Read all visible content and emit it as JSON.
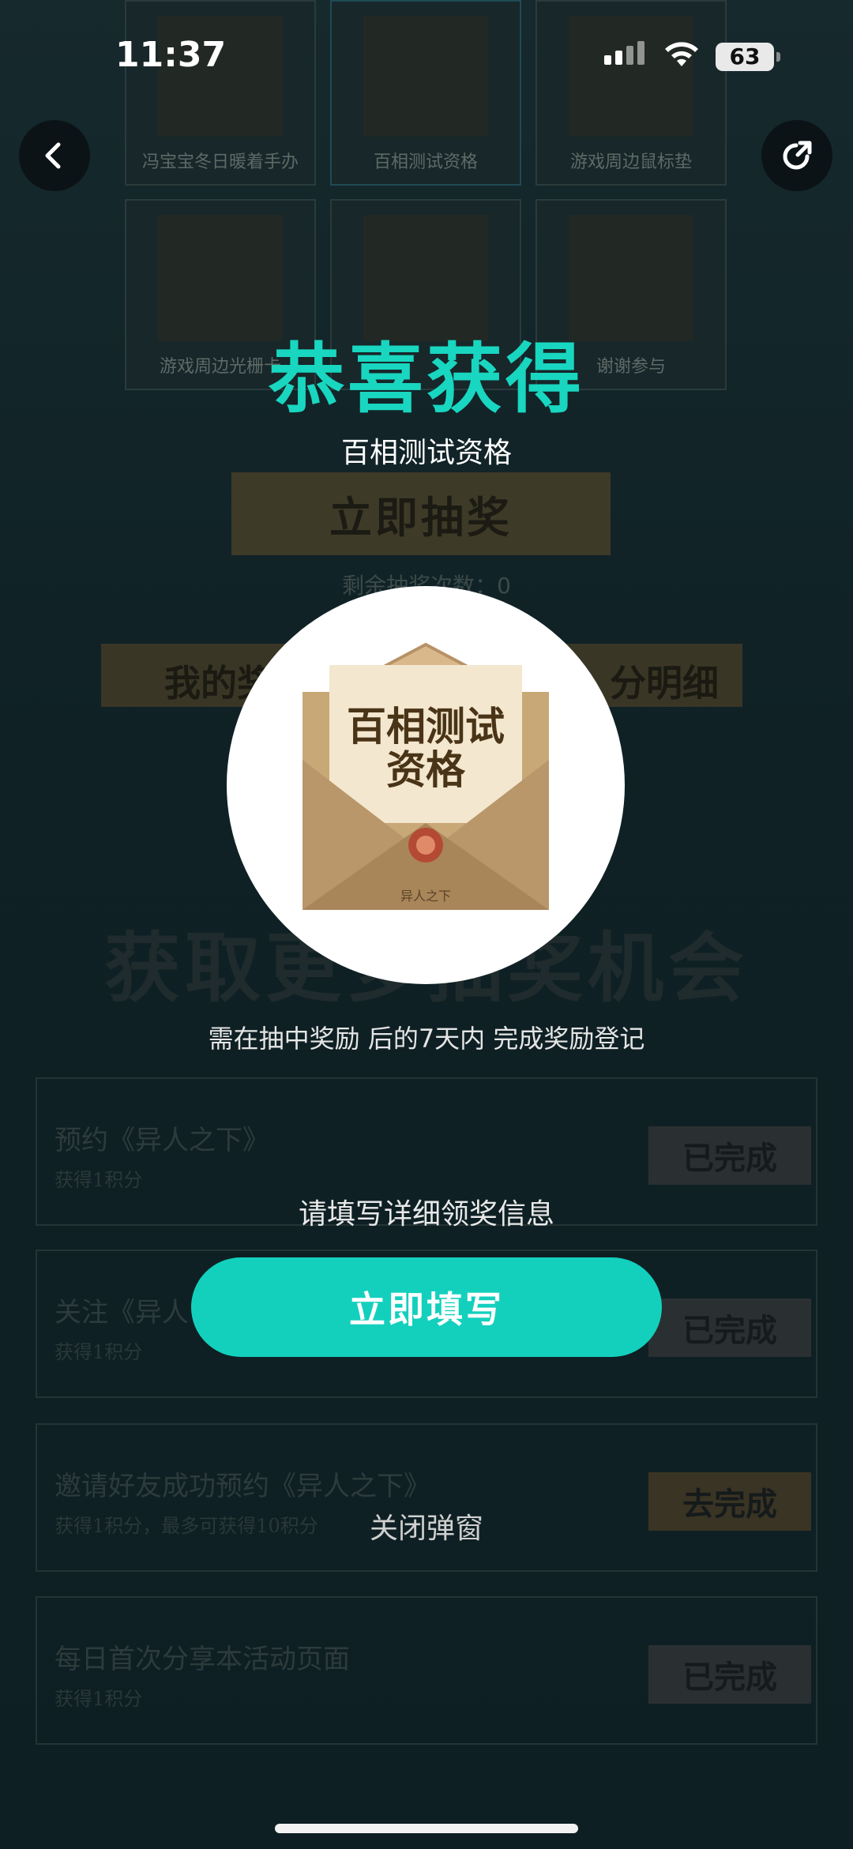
{
  "status_bar": {
    "time": "11:37",
    "battery": "63"
  },
  "background": {
    "prizes": [
      "冯宝宝冬日暖着手办",
      "百相测试资格",
      "游戏周边鼠标垫",
      "游戏周边光栅卡",
      "",
      "谢谢参与"
    ],
    "draw_button": "立即抽奖",
    "remaining_draws": "剩余抽奖次数：0",
    "tab_left": "我的奖",
    "tab_right": "分明细",
    "section_title": "获取更多抽奖机会",
    "tasks": [
      {
        "title": "预约《异人之下》",
        "sub": "获得1积分",
        "button": "已完成"
      },
      {
        "title": "关注《异人",
        "sub": "获得1积分",
        "button": "已完成"
      },
      {
        "title": "邀请好友成功预约《异人之下》",
        "sub": "获得1积分，最多可获得10积分",
        "button": "去完成"
      },
      {
        "title": "每日首次分享本活动页面",
        "sub": "获得1积分",
        "button": "已完成"
      }
    ]
  },
  "modal": {
    "title": "恭喜获得",
    "prize_name": "百相测试资格",
    "envelope_text_line1": "百相测试",
    "envelope_text_line2": "资格",
    "envelope_footer": "异人之下",
    "deadline_note": "需在抽中奖励 后的7天内 完成奖励登记",
    "fill_info_prompt": "请填写详细领奖信息",
    "fill_button": "立即填写",
    "close_link": "关闭弹窗"
  },
  "colors": {
    "accent": "#19d6c0",
    "button": "#13d0bd"
  }
}
